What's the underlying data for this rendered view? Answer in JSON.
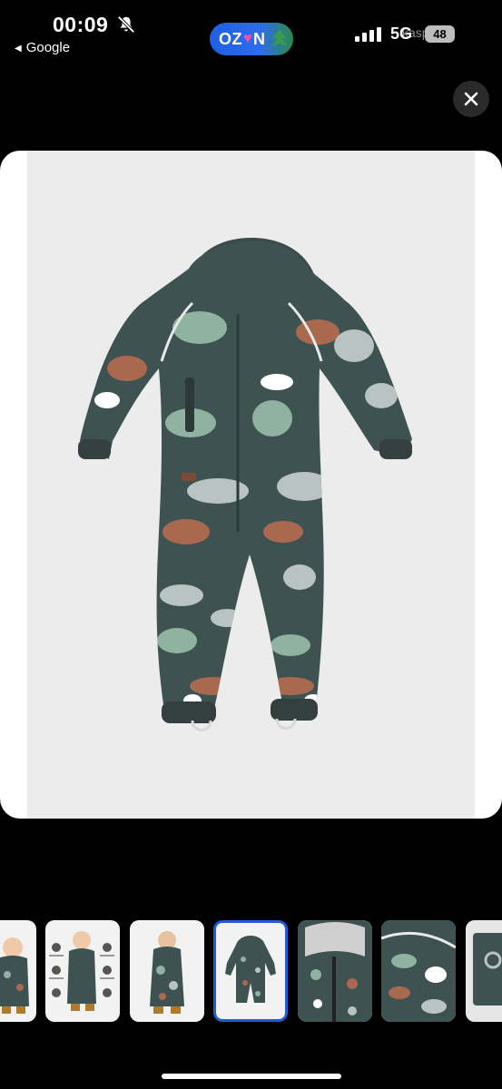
{
  "status_bar": {
    "time": "00:09",
    "back_app": "Google",
    "ozon_logo_left": "OZ",
    "ozon_logo_right": "N",
    "network": "5G",
    "battery": "48",
    "watermark": "kaspi.kz"
  },
  "gallery": {
    "selected_index": 3,
    "thumbnail_count": 7
  },
  "colors": {
    "fabric": "#3f5252",
    "dino_mint": "#8fb3a0",
    "dino_gray": "#b9c3c2",
    "dino_rust": "#a9694f",
    "selection": "#1e5bd8"
  }
}
